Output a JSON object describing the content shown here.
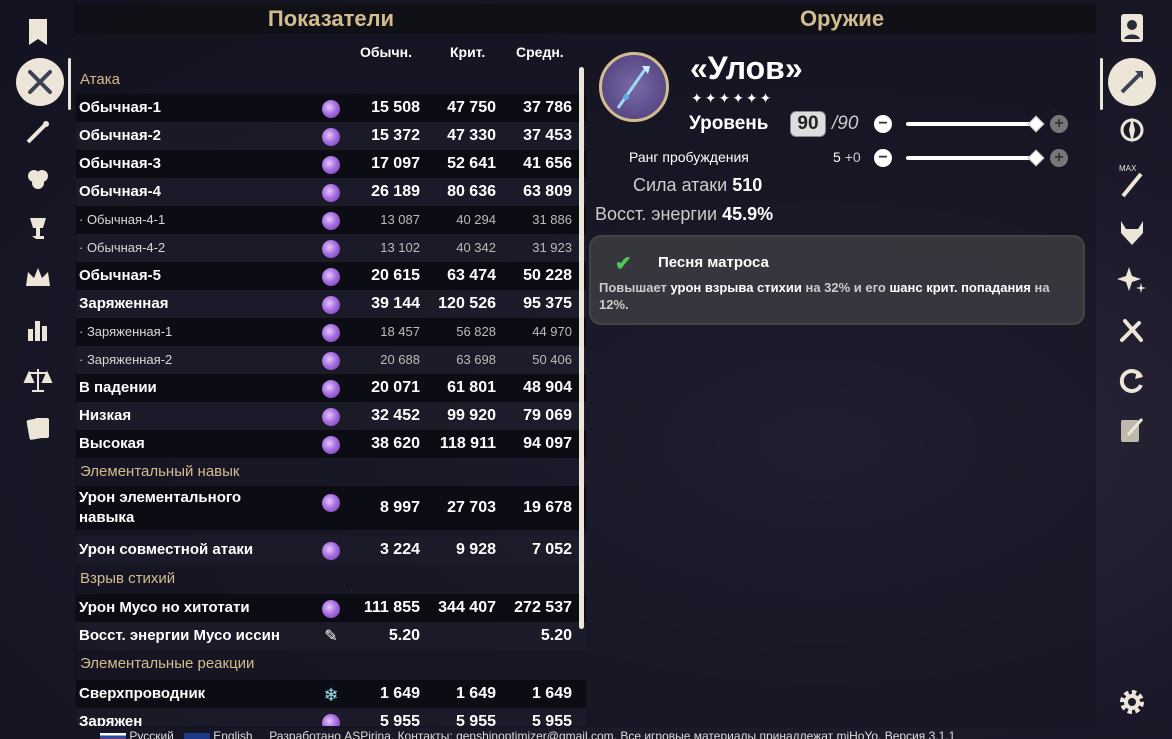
{
  "headers": {
    "stats": "Показатели",
    "weapon": "Оружие"
  },
  "columns": [
    "Обычн.",
    "Крит.",
    "Средн."
  ],
  "sections": {
    "attack": "Атака",
    "skill": "Элементальный навык",
    "burst": "Взрыв стихий",
    "reactions": "Элементальные реакции"
  },
  "rows": [
    {
      "label": "Обычная-1",
      "n": "15 508",
      "c": "47 750",
      "a": "37 786"
    },
    {
      "label": "Обычная-2",
      "n": "15 372",
      "c": "47 330",
      "a": "37 453"
    },
    {
      "label": "Обычная-3",
      "n": "17 097",
      "c": "52 641",
      "a": "41 656"
    },
    {
      "label": "Обычная-4",
      "n": "26 189",
      "c": "80 636",
      "a": "63 809"
    },
    {
      "label": "· Обычная-4-1",
      "n": "13 087",
      "c": "40 294",
      "a": "31 886"
    },
    {
      "label": "· Обычная-4-2",
      "n": "13 102",
      "c": "40 342",
      "a": "31 923"
    },
    {
      "label": "Обычная-5",
      "n": "20 615",
      "c": "63 474",
      "a": "50 228"
    },
    {
      "label": "Заряженная",
      "n": "39 144",
      "c": "120 526",
      "a": "95 375"
    },
    {
      "label": "· Заряженная-1",
      "n": "18 457",
      "c": "56 828",
      "a": "44 970"
    },
    {
      "label": "· Заряженная-2",
      "n": "20 688",
      "c": "63 698",
      "a": "50 406"
    },
    {
      "label": "В падении",
      "n": "20 071",
      "c": "61 801",
      "a": "48 904"
    },
    {
      "label": "Низкая",
      "n": "32 452",
      "c": "99 920",
      "a": "79 069"
    },
    {
      "label": "Высокая",
      "n": "38 620",
      "c": "118 911",
      "a": "94 097"
    },
    {
      "label": "Урон элементального навыка",
      "n": "8 997",
      "c": "27 703",
      "a": "19 678"
    },
    {
      "label": "Урон совместной атаки",
      "n": "3 224",
      "c": "9 928",
      "a": "7 052"
    },
    {
      "label": "Урон Мусо но хитотати",
      "n": "111 855",
      "c": "344 407",
      "a": "272 537"
    },
    {
      "label": "Восст. энергии Мусо иссин",
      "n": "5.20",
      "c": "",
      "a": "5.20"
    },
    {
      "label": "Сверхпроводник",
      "n": "1 649",
      "c": "1 649",
      "a": "1 649"
    },
    {
      "label": "Заряжен",
      "n": "5 955",
      "c": "5 955",
      "a": "5 955"
    }
  ],
  "weapon": {
    "name": "«Улов»",
    "stars": "✦✦✦✦✦✦",
    "level_label": "Уровень",
    "level": "90",
    "level_max": "/90",
    "level_fraction": 1.0,
    "refine_label": "Ранг пробуждения",
    "refine_value": "5",
    "refine_bonus": "+0",
    "refine_fraction": 1.0,
    "atk_label": "Сила атаки",
    "atk_value": "510",
    "er_label": "Восст. энергии",
    "er_value": "45.9%",
    "passive_title": "Песня матроса",
    "passive_desc_1": "Повышает ",
    "passive_desc_2": "урон взрыва стихии",
    "passive_desc_3": " на 32% и его ",
    "passive_desc_4": "шанс крит. попадания",
    "passive_desc_5": " на 12%."
  },
  "footer": {
    "lang_ru": "Русский",
    "lang_en": "English",
    "text": "Разработано ASPirina. Контакты: genshinoptimizer@gmail.com. Все игровые материалы принадлежат miHoYo. Версия 3.1.1"
  },
  "colors": {
    "accent": "#d3bc8e",
    "nav": "#ece5d8",
    "electro": "#a86fe0",
    "cryo": "#9fe2ef"
  }
}
